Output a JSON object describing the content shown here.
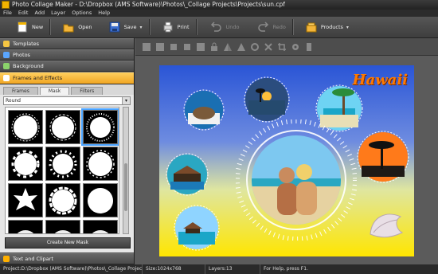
{
  "window": {
    "title": "Photo Collage Maker - D:\\Dropbox (AMS Software)\\Photos\\_Collage Projects\\Projects\\sun.cpf"
  },
  "menu": [
    "File",
    "Edit",
    "Add",
    "Layer",
    "Options",
    "Help"
  ],
  "toolbar": {
    "new": "New",
    "open": "Open",
    "save": "Save",
    "print": "Print",
    "undo": "Undo",
    "redo": "Redo",
    "products": "Products"
  },
  "left_panel": {
    "categories": {
      "templates": "Templates",
      "photos": "Photos",
      "background": "Background",
      "frames_effects": "Frames and Effects",
      "text_clipart": "Text and Clipart"
    },
    "subtabs": [
      "Frames",
      "Mask",
      "Filters"
    ],
    "active_subtab": "Mask",
    "mask_shape_value": "Round",
    "create_mask_button": "Create New Mask"
  },
  "collage": {
    "hawaii_text": "Hawaii"
  },
  "status": {
    "project": "Project:D:\\Dropbox (AMS Software)\\Photos\\_Collage Projects\\Pro...",
    "size": "Size:1024x768",
    "layers": "Layers:13",
    "help": "For Help, press F1."
  },
  "colors": {
    "accent": "#f1a522",
    "canvas_bg": "#5b5b5b"
  }
}
